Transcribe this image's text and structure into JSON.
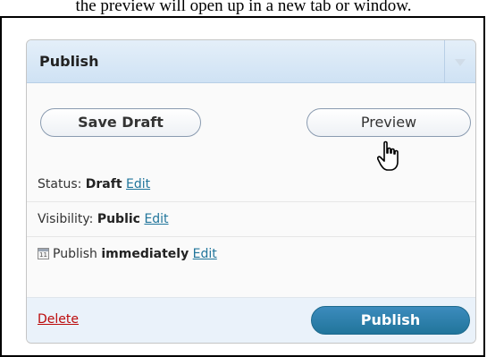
{
  "caption": "the preview will open up in a new tab or window.",
  "publish_box": {
    "title": "Publish",
    "buttons": {
      "save_draft": "Save Draft",
      "preview": "Preview"
    },
    "status": {
      "label": "Status:",
      "value": "Draft",
      "edit": "Edit"
    },
    "visibility": {
      "label": "Visibility:",
      "value": "Public",
      "edit": "Edit"
    },
    "schedule": {
      "icon": "calendar-icon",
      "label": "Publish",
      "value": "immediately",
      "edit": "Edit"
    },
    "footer": {
      "delete": "Delete",
      "publish": "Publish"
    }
  },
  "colors": {
    "link": "#21759b",
    "delete": "#bc0b0b",
    "publish_button": "#21759b",
    "header_bg": "#cfe2f4"
  }
}
